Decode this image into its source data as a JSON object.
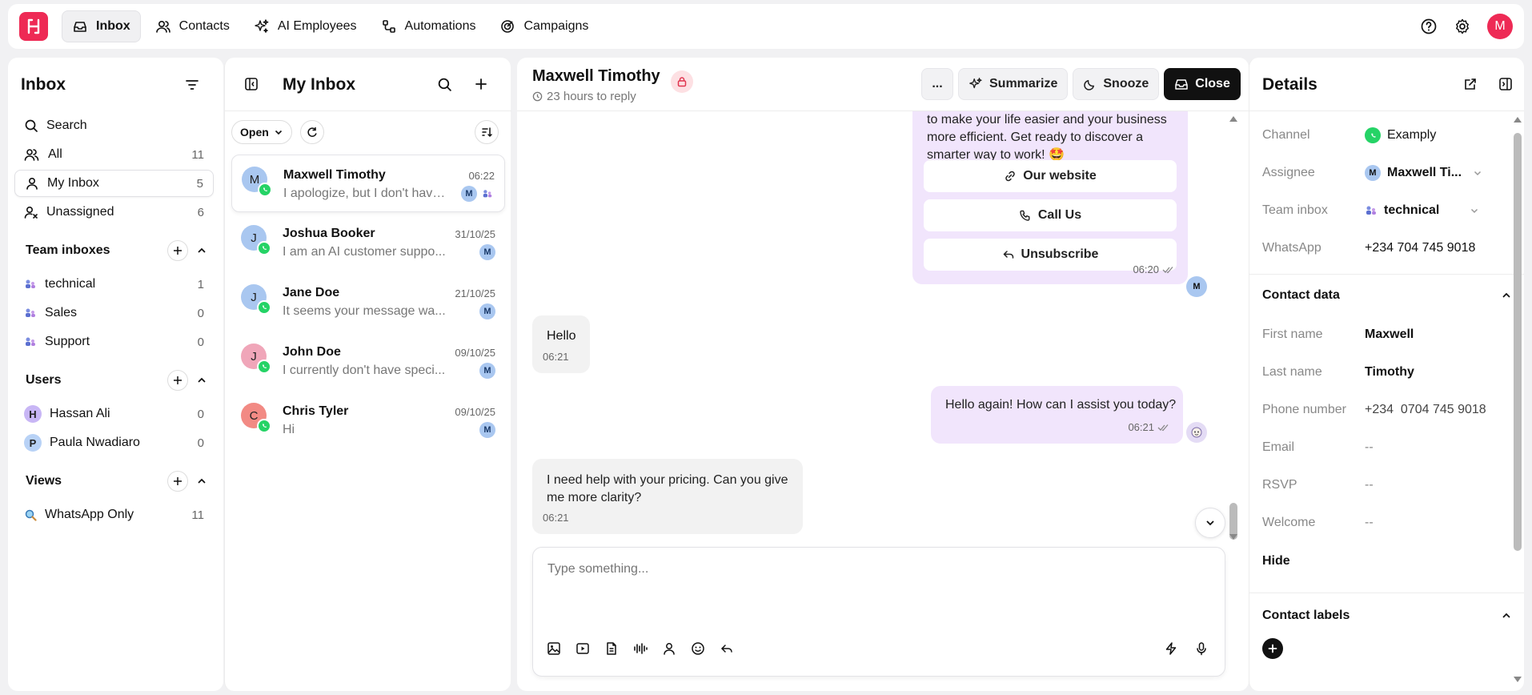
{
  "topnav": {
    "items": [
      {
        "label": "Inbox",
        "icon": "inbox-icon"
      },
      {
        "label": "Contacts",
        "icon": "contacts-icon"
      },
      {
        "label": "AI Employees",
        "icon": "sparkles-icon"
      },
      {
        "label": "Automations",
        "icon": "automations-icon"
      },
      {
        "label": "Campaigns",
        "icon": "campaigns-icon"
      }
    ],
    "avatar_initial": "M"
  },
  "sidebar": {
    "title": "Inbox",
    "items": [
      {
        "label": "Search",
        "count": ""
      },
      {
        "label": "All",
        "count": "11"
      },
      {
        "label": "My Inbox",
        "count": "5"
      },
      {
        "label": "Unassigned",
        "count": "6"
      }
    ],
    "team_header": "Team inboxes",
    "teams": [
      {
        "label": "technical",
        "count": "1"
      },
      {
        "label": "Sales",
        "count": "0"
      },
      {
        "label": "Support",
        "count": "0"
      }
    ],
    "users_header": "Users",
    "users": [
      {
        "initial": "H",
        "label": "Hassan Ali",
        "count": "0"
      },
      {
        "initial": "P",
        "label": "Paula Nwadiaro",
        "count": "0"
      }
    ],
    "views_header": "Views",
    "views": [
      {
        "label": "WhatsApp Only",
        "count": "11"
      }
    ]
  },
  "list": {
    "title": "My Inbox",
    "filter_label": "Open",
    "conversations": [
      {
        "initial": "M",
        "name": "Maxwell Timothy",
        "date": "06:22",
        "preview": "I apologize, but I don't have ...",
        "badge": "M"
      },
      {
        "initial": "J",
        "name": "Joshua Booker",
        "date": "31/10/25",
        "preview": "I am an AI customer suppo...",
        "badge": "M"
      },
      {
        "initial": "J",
        "name": "Jane Doe",
        "date": "21/10/25",
        "preview": "It seems your message wa...",
        "badge": "M"
      },
      {
        "initial": "J",
        "name": "John Doe",
        "date": "09/10/25",
        "preview": "I currently don't have speci...",
        "badge": "M"
      },
      {
        "initial": "C",
        "name": "Chris Tyler",
        "date": "09/10/25",
        "preview": "Hi",
        "badge": "M"
      }
    ]
  },
  "chat": {
    "name": "Maxwell Timothy",
    "reply_time": "23 hours to reply",
    "more_label": "...",
    "summarize_label": "Summarize",
    "snooze_label": "Snooze",
    "close_label": "Close",
    "msg1_line1": "to make your life easier and your business",
    "msg1_line2": "more efficient. Get ready to discover a",
    "msg1_line3": "smarter way to work! 🤩",
    "quick_replies": [
      "Our website",
      "Call Us",
      "Unsubscribe"
    ],
    "msg1_time": "06:20",
    "msg1_avatar": "M",
    "msg2_text": "Hello",
    "msg2_time": "06:21",
    "msg3_text": "Hello again! How can I assist you today?",
    "msg3_time": "06:21",
    "msg4_line1": "I need help with your pricing. Can you give",
    "msg4_line2": "me more clarity?",
    "msg4_time": "06:21",
    "composer_placeholder": "Type something..."
  },
  "details": {
    "title": "Details",
    "channel_label": "Channel",
    "channel_value": "Examply",
    "assignee_label": "Assignee",
    "assignee_initial": "M",
    "assignee_value": "Maxwell Ti...",
    "team_label": "Team inbox",
    "team_value": "technical",
    "whatsapp_label": "WhatsApp",
    "whatsapp_value": "+234 704 745 9018",
    "contact_header": "Contact data",
    "first_label": "First name",
    "first_value": "Maxwell",
    "last_label": "Last name",
    "last_value": "Timothy",
    "phone_label": "Phone number",
    "phone_value": "+234  0704 745 9018",
    "email_label": "Email",
    "email_value": "--",
    "rsvp_label": "RSVP",
    "rsvp_value": "--",
    "welcome_label": "Welcome",
    "welcome_value": "--",
    "hide_label": "Hide",
    "labels_header": "Contact labels"
  },
  "colors": {
    "brand": "#ee2a55",
    "outgoing_bubble": "#f1e5fc",
    "incoming_bubble": "#f2f2f2",
    "whatsapp": "#25d366"
  }
}
